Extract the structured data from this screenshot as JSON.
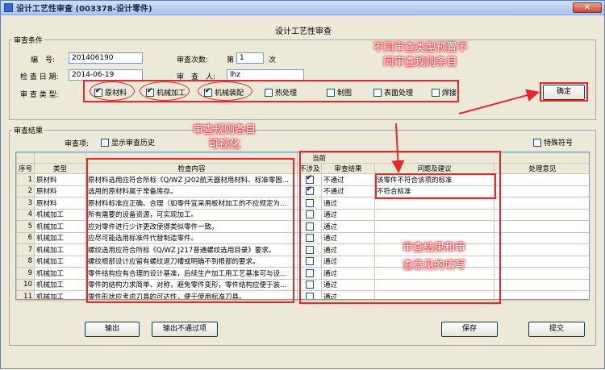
{
  "window": {
    "title": "设计工艺性审查 (003378-设计零件)",
    "close_label": "✕"
  },
  "form_title": "设计工艺性审查",
  "conditions": {
    "group_label": "审查条件",
    "number_label": "编　号:",
    "number_value": "201406190",
    "count_label": "审查次数:",
    "count_prefix": "第",
    "count_value": "1",
    "count_suffix": "次",
    "date_label": "检 查 日 期:",
    "date_value": "2014-06-19",
    "reviewer_label": "审　查　人:",
    "reviewer_value": "lhz",
    "type_label": "审 查 类 型:",
    "types": [
      {
        "label": "原材料",
        "checked": true
      },
      {
        "label": "机械加工",
        "checked": true
      },
      {
        "label": "机械装配",
        "checked": true
      },
      {
        "label": "热处理",
        "checked": false
      },
      {
        "label": "制图",
        "checked": false
      },
      {
        "label": "表面处理",
        "checked": false
      },
      {
        "label": "焊接",
        "checked": false
      }
    ],
    "confirm_label": "确定"
  },
  "results": {
    "group_label": "审查结果",
    "items_label": "审查项:",
    "show_history_label": "显示审查历史",
    "special_symbol_label": "特殊符号",
    "header_top": "当前",
    "columns": [
      "序号",
      "类型",
      "检查内容",
      "不涉及",
      "审查结果",
      "问题及建议",
      "处理意见"
    ],
    "rows": [
      {
        "idx": "1",
        "type": "原材料",
        "content": "原材料选用应符合所标《Q/WZ J202航天器材用材料、标准零固...",
        "na": true,
        "result": "不通过",
        "issue": "该零件不符合该项的标准",
        "handle": ""
      },
      {
        "idx": "2",
        "type": "原材料",
        "content": "选用的原材料属于常备库存。",
        "na": true,
        "result": "不通过",
        "issue": "不符合标准",
        "handle": ""
      },
      {
        "idx": "3",
        "type": "原材料",
        "content": "原材料标准应正确、合理（如零件宜采用板材加工的不应规定为...",
        "na": false,
        "result": "通过",
        "issue": "",
        "handle": ""
      },
      {
        "idx": "4",
        "type": "机械加工",
        "content": "所有需要的设备资源，可实现加工。",
        "na": false,
        "result": "通过",
        "issue": "",
        "handle": ""
      },
      {
        "idx": "5",
        "type": "机械加工",
        "content": "应对零件进行少许更改使得类似零件一致。",
        "na": false,
        "result": "通过",
        "issue": "",
        "handle": ""
      },
      {
        "idx": "6",
        "type": "机械加工",
        "content": "应尽可能选用标准件代替制造零件。",
        "na": false,
        "result": "通过",
        "issue": "",
        "handle": ""
      },
      {
        "idx": "7",
        "type": "机械加工",
        "content": "螺纹选用应符合所标《Q/WZ J217普通螺纹选用目录》要求。",
        "na": false,
        "result": "通过",
        "issue": "",
        "handle": ""
      },
      {
        "idx": "8",
        "type": "机械加工",
        "content": "螺纹根部设计应留有螺纹退刀槽或明确不到根部的要求。",
        "na": false,
        "result": "通过",
        "issue": "",
        "handle": ""
      },
      {
        "idx": "9",
        "type": "机械加工",
        "content": "零件结构应有合理的设计基准，后续生产加工用工艺基准可与设...",
        "na": false,
        "result": "通过",
        "issue": "",
        "handle": ""
      },
      {
        "idx": "10",
        "type": "机械加工",
        "content": "零件的结构力求简单、对称，避免零件变形，零件结构应便于装...",
        "na": false,
        "result": "通过",
        "issue": "",
        "handle": ""
      },
      {
        "idx": "11",
        "type": "机械加工",
        "content": "零件形状应考虑刀具的可达性，便于使用标准刀具。",
        "na": false,
        "result": "通过",
        "issue": "",
        "handle": ""
      }
    ]
  },
  "buttons": {
    "export": "输出",
    "export_failed": "输出不通过项",
    "save": "保存",
    "submit": "提交"
  },
  "annotations": {
    "preset_rules": [
      "不同审查类型预置不",
      "同审查规则条目"
    ],
    "visual_rules": [
      "审查规则条目",
      "可视化"
    ],
    "fill_results": [
      "审查结果和审",
      "查意见的填写"
    ]
  }
}
